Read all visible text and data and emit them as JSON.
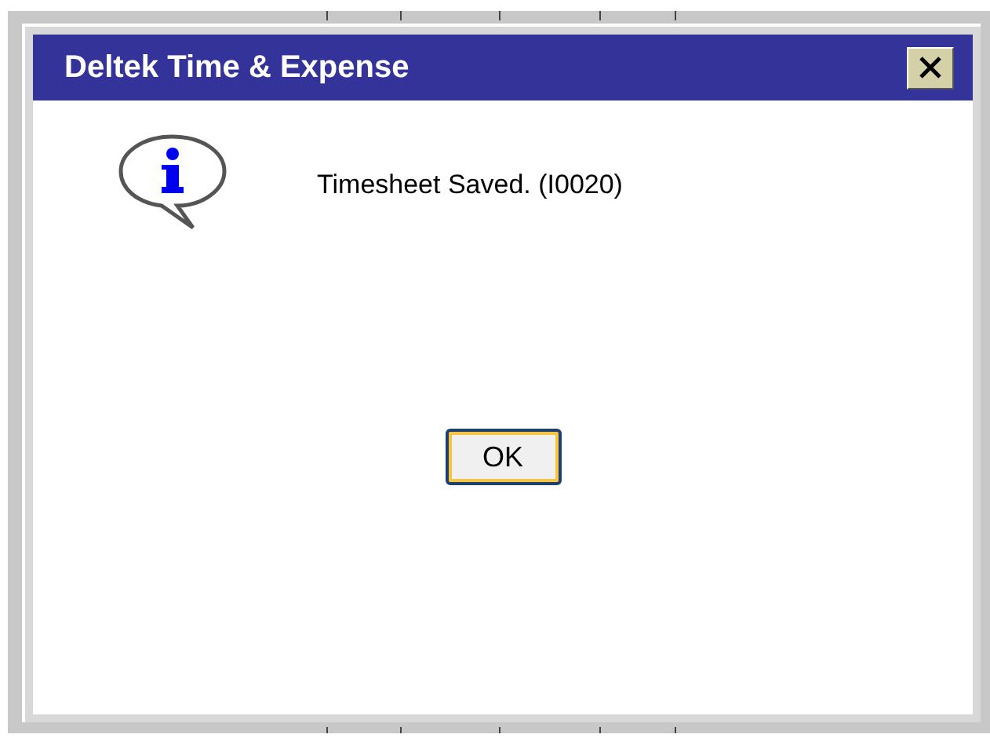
{
  "dialog": {
    "title": "Deltek Time & Expense",
    "message": "Timesheet Saved. (I0020)",
    "buttons": [
      {
        "label": "OK",
        "focused": true
      }
    ]
  }
}
